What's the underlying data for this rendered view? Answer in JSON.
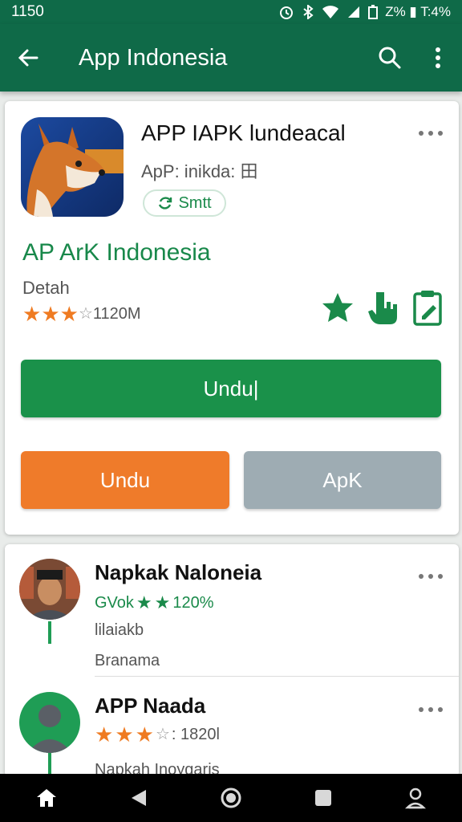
{
  "status_bar": {
    "time": "1150",
    "right_text": "Z% ▮ T:4%"
  },
  "app_bar": {
    "title": "App Indonesia"
  },
  "featured": {
    "app_name": "APP IAPK lundeacal",
    "sub": "ApP: inikda: 田",
    "chip_label": "Smtt",
    "green_title": "AP ArK Indonesia",
    "developer": "Detah",
    "rating_stars": 3.5,
    "rating_text": "1120M",
    "primary_button": "Undu|",
    "orange_button": "Undu",
    "gray_button": "ApK"
  },
  "list": [
    {
      "title": "Napkak Naloneia",
      "meta_prefix": "GVok",
      "meta_value": "120%",
      "line1": "lilaiakb",
      "line2": "Branama"
    },
    {
      "title": "APP Naada",
      "rating_stars": 3,
      "rating_text": ": 1820l",
      "desc": "Napkah Inoygaris"
    }
  ],
  "colors": {
    "primary": "#0f6a48",
    "accent_green": "#1a914a",
    "orange": "#ef7b2a",
    "gray": "#9eacb3"
  },
  "nav_icons": [
    "home-icon",
    "back-icon",
    "circle-home-icon",
    "recents-icon",
    "profile-icon"
  ]
}
